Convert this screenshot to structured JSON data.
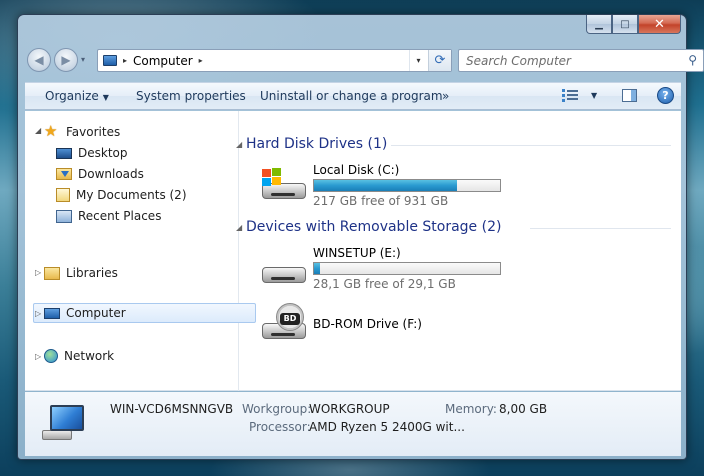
{
  "window": {
    "caption_buttons": {
      "minimize": "▁",
      "maximize": "□",
      "close": "✕"
    }
  },
  "nav": {
    "back_icon": "◀",
    "forward_icon": "▶",
    "dropdown_icon": "▾",
    "address": {
      "separator": "▸",
      "location": "Computer",
      "trailing_separator": "▸",
      "dropdown_icon": "▾",
      "refresh_icon": "⟳"
    },
    "search": {
      "placeholder": "Search Computer",
      "icon": "⚲"
    }
  },
  "toolbar": {
    "organize": "Organize",
    "organize_caret": "▼",
    "system_properties": "System properties",
    "uninstall": "Uninstall or change a program",
    "more": "»",
    "view_caret": "▼",
    "help": "?"
  },
  "nav_pane": {
    "favorites": {
      "label": "Favorites",
      "expander": "◢",
      "items": [
        {
          "label": "Desktop"
        },
        {
          "label": "Downloads"
        },
        {
          "label": "My Documents (2)"
        },
        {
          "label": "Recent Places"
        }
      ]
    },
    "libraries": {
      "label": "Libraries",
      "expander": "▷"
    },
    "computer": {
      "label": "Computer",
      "expander": "▷"
    },
    "network": {
      "label": "Network",
      "expander": "▷"
    }
  },
  "main": {
    "groups": [
      {
        "header": "Hard Disk Drives (1)",
        "drives": [
          {
            "label": "Local Disk (C:)",
            "free_text": "217 GB free of 931 GB",
            "used_fraction": 0.767
          }
        ]
      },
      {
        "header": "Devices with Removable Storage (2)",
        "drives": [
          {
            "label": "WINSETUP (E:)",
            "free_text": "28,1 GB free of 29,1 GB",
            "used_fraction": 0.034
          },
          {
            "label": "BD-ROM Drive (F:)",
            "badge": "BD"
          }
        ]
      }
    ]
  },
  "details": {
    "computer_name": "WIN-VCD6MSNNGVB",
    "workgroup_label": "Workgroup:",
    "workgroup_value": "WORKGROUP",
    "memory_label": "Memory:",
    "memory_value": "8,00 GB",
    "processor_label": "Processor:",
    "processor_value": "AMD Ryzen 5 2400G wit..."
  },
  "colors": {
    "group_header": "#1e3287",
    "drive_bar": "#2a9ad0",
    "windows_flag": [
      "#f25022",
      "#7fba00",
      "#00a4ef",
      "#ffb900"
    ]
  }
}
